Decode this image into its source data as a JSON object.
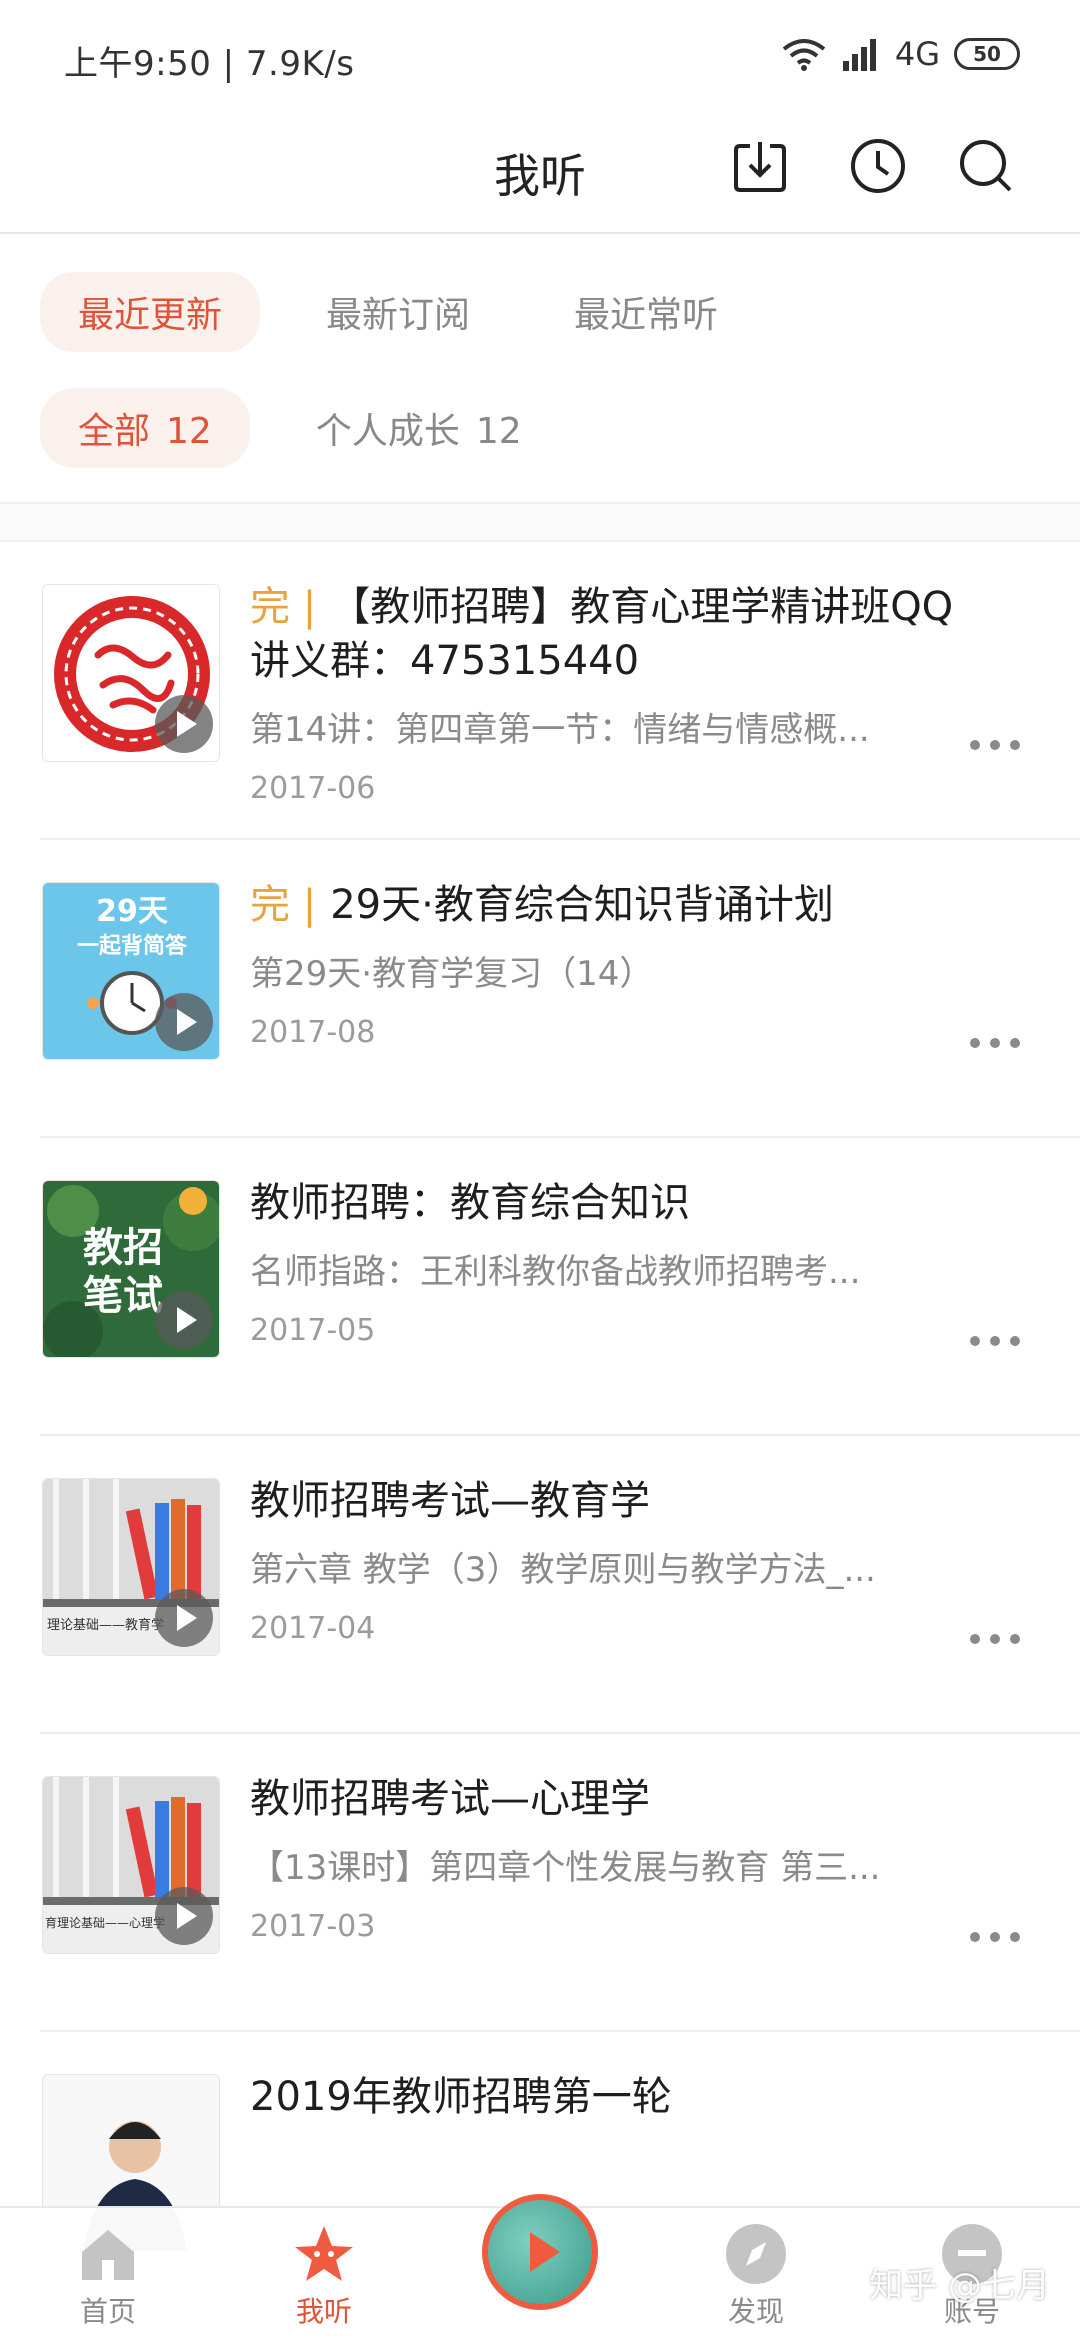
{
  "status_bar": {
    "time_speed": "上午9:50 | 7.9K/s",
    "network": "4G",
    "battery": "50"
  },
  "header": {
    "title": "我听",
    "icons": [
      "download-icon",
      "history-clock-icon",
      "search-icon"
    ]
  },
  "tabs": [
    {
      "label": "最近更新",
      "active": true
    },
    {
      "label": "最新订阅",
      "active": false
    },
    {
      "label": "最近常听",
      "active": false
    }
  ],
  "filters": [
    {
      "label": "全部",
      "count": "12",
      "active": true
    },
    {
      "label": "个人成长",
      "count": "12",
      "active": false
    }
  ],
  "items": [
    {
      "done": "完 |",
      "title": "【教师招聘】教育心理学精讲班QQ讲义群：475315440",
      "subtitle": "第14讲：第四章第一节：情绪与情感概...",
      "date": "2017-06"
    },
    {
      "done": "完 |",
      "title": "29天·教育综合知识背诵计划",
      "subtitle": "第29天·教育学复习（14）",
      "date": "2017-08",
      "thumb_text_1": "29天",
      "thumb_text_2": "一起背简答"
    },
    {
      "done": "",
      "title": "教师招聘：教育综合知识",
      "subtitle": "名师指路：王利科教你备战教师招聘考...",
      "date": "2017-05",
      "thumb_text_1": "教招",
      "thumb_text_2": "笔试"
    },
    {
      "done": "",
      "title": "教师招聘考试—教育学",
      "subtitle": "第六章 教学（3）教学原则与教学方法_...",
      "date": "2017-04",
      "thumb_text_1": "理论基础——教育学"
    },
    {
      "done": "",
      "title": "教师招聘考试—心理学",
      "subtitle": "【13课时】第四章个性发展与教育 第三...",
      "date": "2017-03",
      "thumb_text_1": "育理论基础——心理学"
    },
    {
      "done": "",
      "title": "2019年教师招聘第一轮",
      "subtitle": "",
      "date": ""
    }
  ],
  "bottom_nav": [
    {
      "label": "首页",
      "icon": "home-icon",
      "active": false
    },
    {
      "label": "我听",
      "icon": "star-icon",
      "active": true
    },
    {
      "label": "发现",
      "icon": "compass-icon",
      "active": false
    },
    {
      "label": "账号",
      "icon": "account-icon",
      "active": false
    }
  ],
  "watermark": "知乎 @七月",
  "colors": {
    "accent": "#e0533b",
    "done": "#e9a33d"
  }
}
